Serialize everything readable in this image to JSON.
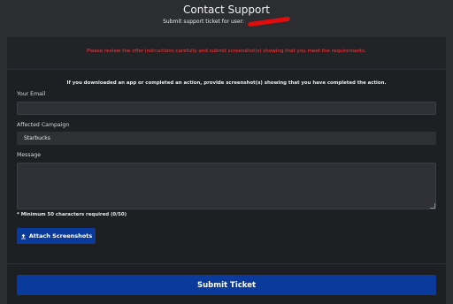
{
  "header": {
    "title": "Contact Support",
    "subtitle": "Submit support ticket for user:"
  },
  "notice": {
    "warning": "Please review the offer instructions carefully and submit screenshot(s) showing that you meet the requirements.",
    "instruction": "If you downloaded an app or completed an action, provide screenshot(s) showing that you have completed the action."
  },
  "form": {
    "email_label": "Your Email",
    "email_value": "",
    "campaign_label": "Affected Campaign",
    "campaign_value": "Starbucks",
    "message_label": "Message",
    "message_value": "",
    "min_chars_hint": "* Minimum 50 characters required (0/50)",
    "attach_label": "Attach Screenshots",
    "submit_label": "Submit Ticket"
  },
  "colors": {
    "background": "#2b2d31",
    "panel": "#1d1f22",
    "warning": "#ff3b3b",
    "button": "#0a3a9c",
    "redaction": "#e00d0d"
  },
  "icons": {
    "attach": "upload-icon"
  }
}
